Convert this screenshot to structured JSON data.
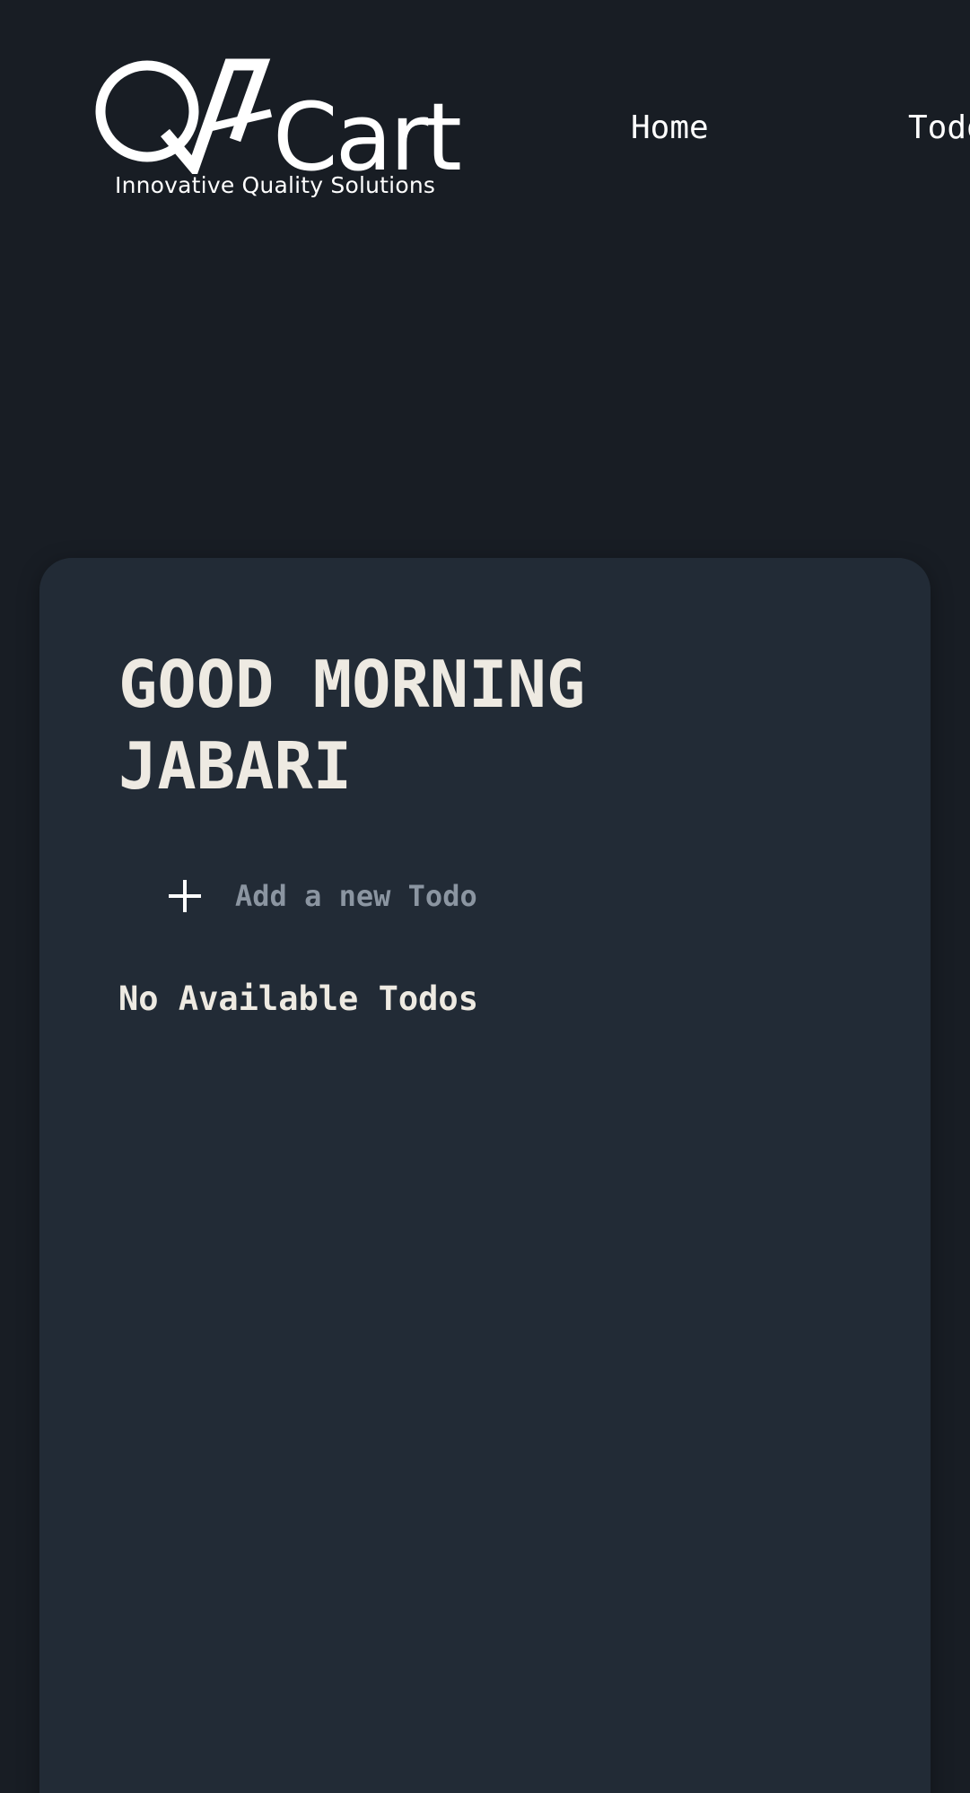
{
  "header": {
    "logo": {
      "brand_text": "QACart",
      "tagline": "Innovative Quality Solutions",
      "icon": "qacart-logo"
    },
    "nav": {
      "home_label": "Home",
      "todos_label": "Todos"
    }
  },
  "main": {
    "greeting": "GOOD MORNING JABARI",
    "add_todo": {
      "button_icon": "plus-icon",
      "placeholder": "Add a new Todo",
      "value": ""
    },
    "empty_message": "No Available Todos"
  },
  "colors": {
    "page_background": "#181d24",
    "card_background": "#222b36",
    "text_primary": "#eeeae2",
    "text_placeholder": "#8b95a1",
    "nav_text": "#ffffff"
  }
}
